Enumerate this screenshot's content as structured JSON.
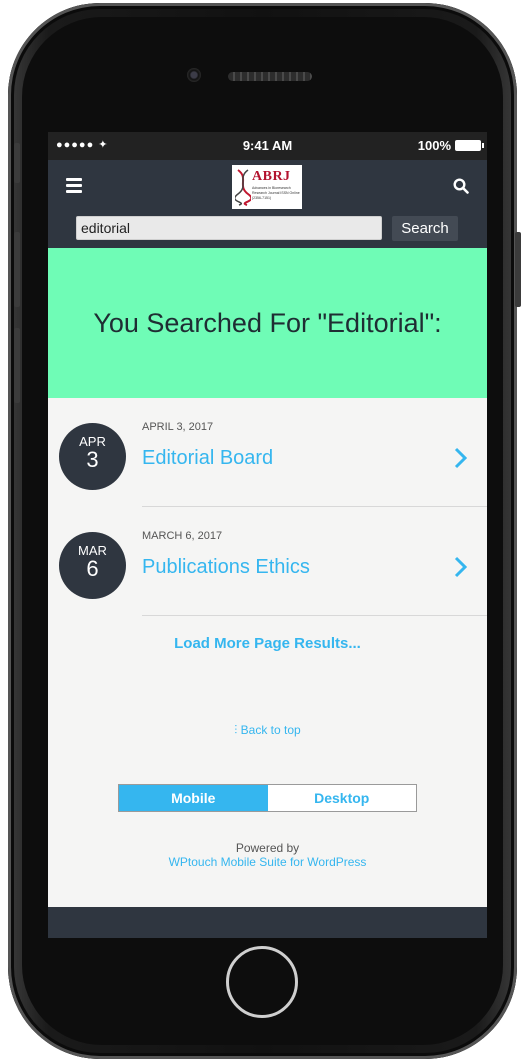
{
  "statusbar": {
    "signal": "●●●●● ✦",
    "time": "9:41 AM",
    "battery": "100%"
  },
  "header": {
    "logo_text": "ABRJ",
    "logo_subtitle": "Advances in Bioresearch Research Journal ISSN Online (2356-7151)"
  },
  "search": {
    "value": "editorial",
    "button_label": "Search"
  },
  "hero": {
    "title": "You Searched For \"Editorial\":"
  },
  "results": [
    {
      "month": "APR",
      "day": "3",
      "date": "APRIL 3, 2017",
      "title": "Editorial Board"
    },
    {
      "month": "MAR",
      "day": "6",
      "date": "MARCH 6, 2017",
      "title": "Publications Ethics"
    }
  ],
  "load_more": "Load More Page Results...",
  "back_to_top": "Back to top",
  "view_switch": {
    "mobile": "Mobile",
    "desktop": "Desktop",
    "active": "mobile"
  },
  "footer": {
    "powered_by": "Powered by",
    "suite": "WPtouch Mobile Suite for WordPress"
  },
  "colors": {
    "accent": "#35b6ef",
    "hero_bg": "#6ffcb6",
    "header_bg": "#2f3640"
  },
  "icons": {
    "menu": "hamburger-icon",
    "search": "search-icon",
    "chevron": "chevron-right-icon",
    "back_to_top": "double-chevron-up-icon"
  }
}
